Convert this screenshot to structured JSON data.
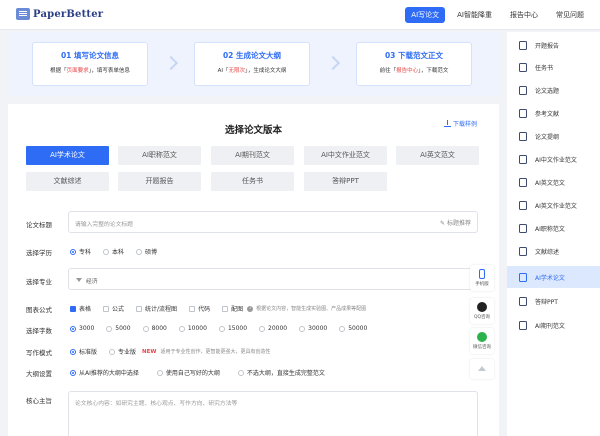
{
  "brand": {
    "name": "PaperBetter"
  },
  "nav": [
    {
      "label": "AI写论文",
      "active": true
    },
    {
      "label": "AI智能降重",
      "active": false
    },
    {
      "label": "报告中心",
      "active": false
    },
    {
      "label": "常见问题",
      "active": false
    }
  ],
  "steps": [
    {
      "title": "01  填写论文信息",
      "desc_pre": "根据「",
      "desc_hl": "页面要求",
      "desc_post": "」，填写表单信息"
    },
    {
      "title": "02  生成论文大纲",
      "desc_pre": "AI「",
      "desc_hl": "无限次",
      "desc_post": "」，生成论文大纲"
    },
    {
      "title": "03  下载范文正文",
      "desc_pre": "前往「",
      "desc_hl": "报告中心",
      "desc_post": "」，下载范文"
    }
  ],
  "card": {
    "title": "选择论文版本",
    "sample_link": "下载样例"
  },
  "versions": [
    {
      "label": "AI学术论文",
      "active": true
    },
    {
      "label": "AI职称范文",
      "active": false
    },
    {
      "label": "AI期刊范文",
      "active": false
    },
    {
      "label": "AI中文作业范文",
      "active": false
    },
    {
      "label": "AI英文范文",
      "active": false
    },
    {
      "label": "文献综述",
      "active": false
    },
    {
      "label": "开题报告",
      "active": false
    },
    {
      "label": "任务书",
      "active": false
    },
    {
      "label": "答辩PPT",
      "active": false
    }
  ],
  "form": {
    "title_label": "论文标题",
    "title_placeholder": "请输入完整的论文标题",
    "title_recommend": "标题推荐",
    "degree_label": "选择学历",
    "degree_options": [
      {
        "label": "专科",
        "selected": true
      },
      {
        "label": "本科",
        "selected": false
      },
      {
        "label": "硕博",
        "selected": false
      }
    ],
    "major_label": "选择专业",
    "major_value": "经济",
    "chart_label": "图表公式",
    "chart_options": [
      {
        "label": "表格",
        "checked": true
      },
      {
        "label": "公式",
        "checked": false
      },
      {
        "label": "统计/流程图",
        "checked": false
      },
      {
        "label": "代码",
        "checked": false
      },
      {
        "label": "配图",
        "checked": false
      }
    ],
    "chart_note": "根据论文内容，智能生成实验图、产品成果等配图",
    "words_label": "选择字数",
    "words_options": [
      {
        "label": "3000",
        "selected": true
      },
      {
        "label": "5000",
        "selected": false
      },
      {
        "label": "8000",
        "selected": false
      },
      {
        "label": "10000",
        "selected": false
      },
      {
        "label": "15000",
        "selected": false
      },
      {
        "label": "20000",
        "selected": false
      },
      {
        "label": "30000",
        "selected": false
      },
      {
        "label": "50000",
        "selected": false
      }
    ],
    "mode_label": "写作模式",
    "mode_standard": "标准版",
    "mode_pro": "专业版",
    "mode_new": "NEW",
    "mode_note": "适用于专业性创作，更智能更强大，更具有创造性",
    "outline_label": "大纲设置",
    "outline_options": [
      {
        "label": "从AI推荐的大纲中选择",
        "selected": true
      },
      {
        "label": "使用自己写好的大纲",
        "selected": false
      },
      {
        "label": "不选大纲，直接生成完整范文",
        "selected": false
      }
    ],
    "core_label": "核心主旨",
    "core_placeholder": "论文核心内容：如研究主题、核心观点、写作方向、研究方法等"
  },
  "float_tools": [
    {
      "label": "手机版",
      "icon": "phone-icon"
    },
    {
      "label": "QQ咨询",
      "icon": "qq-icon"
    },
    {
      "label": "微信咨询",
      "icon": "wechat-icon"
    },
    {
      "label": "",
      "icon": "back-to-top-icon"
    }
  ],
  "sidebar": [
    {
      "label": "开题报告",
      "active": false
    },
    {
      "label": "任务书",
      "active": false
    },
    {
      "label": "论文选题",
      "active": false
    },
    {
      "label": "参考文献",
      "active": false
    },
    {
      "label": "论文提纲",
      "active": false
    },
    {
      "label": "AI中文作业范文",
      "active": false
    },
    {
      "label": "AI英文范文",
      "active": false
    },
    {
      "label": "AI英文作业范文",
      "active": false
    },
    {
      "label": "AI职称范文",
      "active": false
    },
    {
      "label": "文献综述",
      "active": false
    },
    {
      "label": "AI学术论文",
      "active": true
    },
    {
      "label": "答辩PPT",
      "active": false
    },
    {
      "label": "AI期刊范文",
      "active": false
    }
  ],
  "colors": {
    "accent": "#2f6cf6",
    "highlight": "#e94545",
    "banner_bg": "#eef3fd",
    "page_bg": "#f1f3f7"
  }
}
